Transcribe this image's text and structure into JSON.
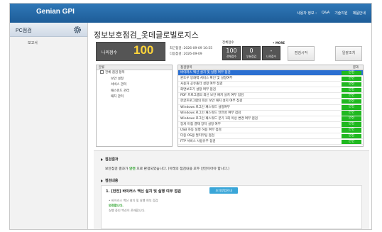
{
  "header": {
    "logo": "Genian GPI",
    "menu": [
      "사용자 정보 :",
      "Q&A",
      "기술지원",
      "제품안내"
    ]
  },
  "sidebar": {
    "title": "PC점검",
    "gear_icon": "gear-icon",
    "items": [
      "보고서"
    ]
  },
  "main": {
    "page_title": "정보보호점검_옷데글로벌로지스",
    "score": {
      "label": "나의점수",
      "value": "100"
    },
    "dates": {
      "recent": "최근점검: 2026-09-09 10:55",
      "next": "다음점검: 2026-09-09"
    },
    "stats_title": "전체점수",
    "stats_sub": "• MORE",
    "stats": [
      {
        "num": "100",
        "label": "전체점수"
      },
      {
        "num": "0",
        "label": "부분점검"
      },
      {
        "num": "-",
        "label": "나의점수"
      }
    ],
    "buttons": {
      "start": "점검시작",
      "close": "일괄조치"
    },
    "category_header": "분류",
    "categories": [
      {
        "label": "전체 점검 항목",
        "level": 0
      },
      {
        "label": "보안 설정",
        "level": 1
      },
      {
        "label": "서비스 관리",
        "level": 1
      },
      {
        "label": "패스워드 관리",
        "level": 1
      },
      {
        "label": "패치 관리",
        "level": 1
      }
    ],
    "items_header": "점검항목",
    "result_header": "결과",
    "items": [
      {
        "label": "바이러스 백신 설치 및 실행 여부 점검",
        "result": "안전",
        "selected": true
      },
      {
        "label": "윈도우 방화벽 서비스 확인 및 설정여부",
        "result": "안전"
      },
      {
        "label": "사용자 공유폴더 설정 여부 점검",
        "result": "안전"
      },
      {
        "label": "화면보호기 설정 여부 점검",
        "result": "안전"
      },
      {
        "label": "PDF 프로그램의 최신 보안 패치 설치 여부 점검",
        "result": "안전"
      },
      {
        "label": "한글프로그램의 최신 보안 패치 설치 여부 점검",
        "result": "안전"
      },
      {
        "label": "Windows 로그인 패스워드 설정여부",
        "result": "안전"
      },
      {
        "label": "Windows 로그인 패스워드 안전성 여부 점검",
        "result": "안전"
      },
      {
        "label": "Windows 로그인 패스워드 분기 1회 이상 변경 여부 점검",
        "result": "안전"
      },
      {
        "label": "장게 미접 결재 장치 설정 여부",
        "result": "안전"
      },
      {
        "label": "USB 자동 실행 허용 여부 점검",
        "result": "안전"
      },
      {
        "label": "다중 OS용 멀티부팅 점검",
        "result": "안전"
      },
      {
        "label": "FTP 서비스 사용유무 점검",
        "result": "안전"
      }
    ],
    "result_section": {
      "title": "점검결과",
      "summary_pre": "보안점검 결과가 ",
      "summary_ok": "안전",
      "summary_post": " 으로 판정되었습니다. (아래의 점검내용 모두 안전이어야 합니다.)"
    },
    "detail_section": {
      "title": "점검내용",
      "item_title": "1. [안전] 바이러스 백신 설치 및 실행 여부 점검",
      "item_button": "조치방법안내",
      "lines": [
        "• 바이러스 백신 설치 및 실행 여부 점검",
        "안전합니다.",
        "실행 중인 백신이 존재합니다."
      ]
    }
  }
}
